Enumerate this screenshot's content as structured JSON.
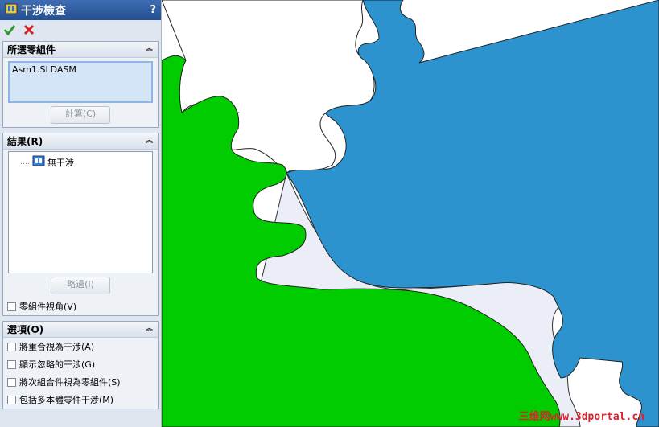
{
  "panel": {
    "title": "干涉檢查",
    "help": "?",
    "selected_group": {
      "header": "所選零組件",
      "item": "Asm1.SLDASM",
      "calc_button": "計算(C)"
    },
    "results_group": {
      "header": "結果(R)",
      "item": "無干涉",
      "ignore_button": "略過(I)",
      "component_view_label": "零組件視角(V)"
    },
    "options_group": {
      "header": "選項(O)",
      "options": [
        "將重合視為干涉(A)",
        "顯示忽略的干涉(G)",
        "將次組合件視為零組件(S)",
        "包括多本體零件干涉(M)"
      ]
    }
  },
  "colors": {
    "green_gear": "#00cc00",
    "blue_gear": "#2c93cf",
    "clearance": "#ebeef6"
  },
  "watermark": "三维网www.3dportal.cn"
}
